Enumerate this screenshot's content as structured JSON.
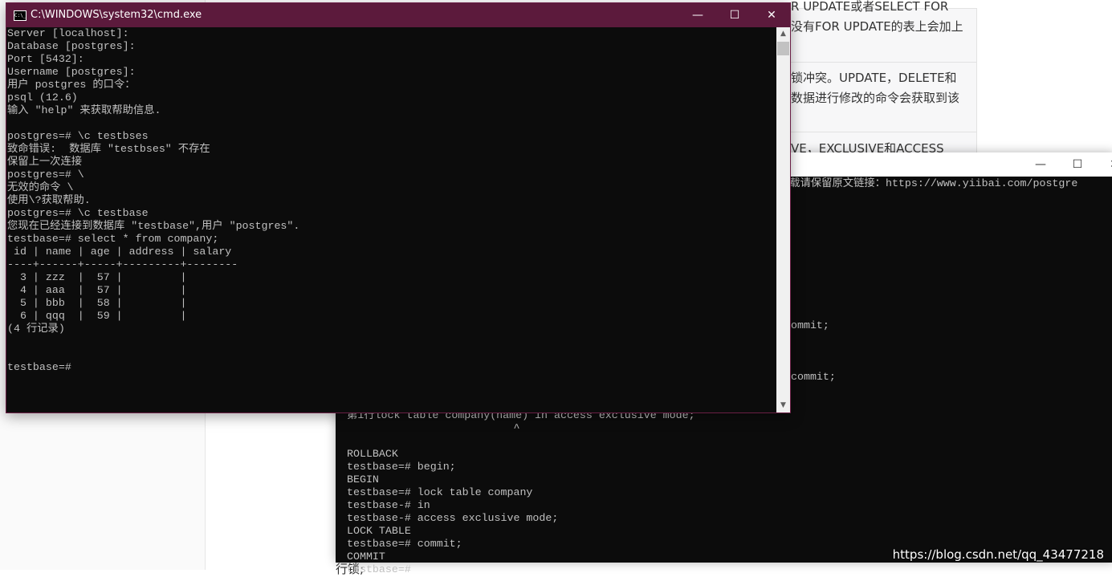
{
  "background_page": {
    "cells": [
      {
        "lines": [
          "R UPDATE或者SELECT FOR",
          "没有FOR UPDATE的表上会加上"
        ]
      },
      {
        "lines": [
          "锁冲突。UPDATE，DELETE和",
          "数据进行修改的命令会获取到该"
        ]
      },
      {
        "lines": [
          "VE，EXCLUSIVE和ACCESS"
        ]
      }
    ],
    "bottom_fragment": "行锁;",
    "watermark": "https://blog.csdn.net/qq_43477218"
  },
  "window_back": {
    "visible_fragments": [
      "转载请保留原文链接：https://www.yiibai.com/postgre",
      "ommit;",
      "commit;"
    ],
    "lines": [
      "第1行lock table company(name) in access exclusive mode;",
      "                          ^",
      "",
      "ROLLBACK",
      "testbase=# begin;",
      "BEGIN",
      "testbase=# lock table company",
      "testbase-# in",
      "testbase-# access exclusive mode;",
      "LOCK TABLE",
      "testbase=# commit;",
      "COMMIT",
      "testbase=#"
    ],
    "controls": {
      "minimize": "—",
      "maximize": "☐",
      "close": "✕"
    }
  },
  "window_front": {
    "title": "C:\\WINDOWS\\system32\\cmd.exe",
    "icon": "C:\\_",
    "controls": {
      "minimize": "—",
      "maximize": "☐",
      "close": "✕"
    },
    "colors": {
      "titlebar": "#5c1a3c",
      "console_bg": "#0c0c0c",
      "console_fg": "#c0c0c0"
    },
    "lines": [
      "Server [localhost]:",
      "Database [postgres]:",
      "Port [5432]:",
      "Username [postgres]:",
      "用户 postgres 的口令：",
      "psql (12.6)",
      "输入 \"help\" 来获取帮助信息.",
      "",
      "postgres=# \\c testbses",
      "致命错误:  数据库 \"testbses\" 不存在",
      "保留上一次连接",
      "postgres=# \\",
      "无效的命令 \\",
      "使用\\?获取帮助.",
      "postgres=# \\c testbase",
      "您现在已经连接到数据库 \"testbase\",用户 \"postgres\".",
      "testbase=# select * from company;",
      " id | name | age | address | salary",
      "----+------+-----+---------+--------",
      "  3 | zzz  |  57 |         |",
      "  4 | aaa  |  57 |         |",
      "  5 | bbb  |  58 |         |",
      "  6 | qqq  |  59 |         |",
      "(4 行记录)",
      "",
      "",
      "testbase=#"
    ]
  }
}
